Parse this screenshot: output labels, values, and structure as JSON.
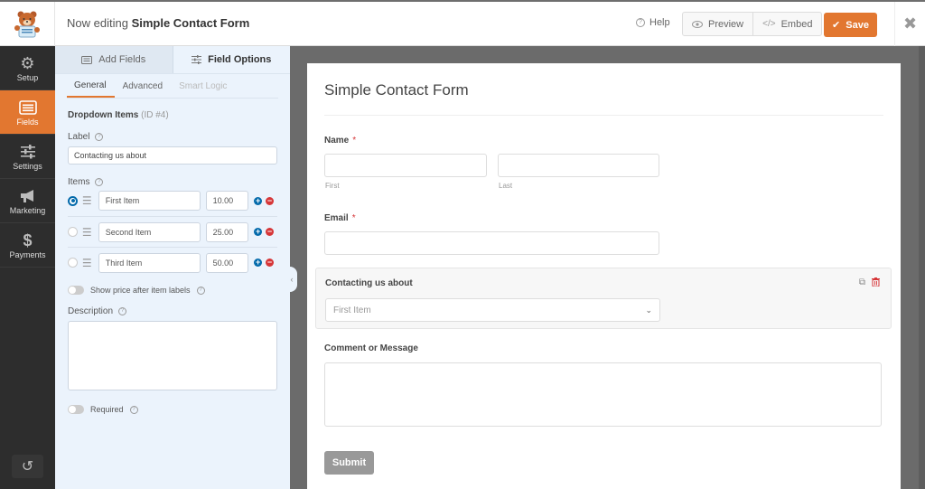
{
  "header": {
    "title_prefix": "Now editing",
    "form_name": "Simple Contact Form",
    "help_label": "Help",
    "preview_label": "Preview",
    "embed_label": "Embed",
    "save_label": "Save",
    "accent_color": "#e27730"
  },
  "leftnav": {
    "items": [
      {
        "label": "Setup",
        "icon": "gear-icon"
      },
      {
        "label": "Fields",
        "icon": "fields-icon",
        "active": true
      },
      {
        "label": "Settings",
        "icon": "sliders-icon"
      },
      {
        "label": "Marketing",
        "icon": "megaphone-icon"
      },
      {
        "label": "Payments",
        "icon": "dollar-icon"
      }
    ],
    "revisions_icon": "history-icon"
  },
  "panel": {
    "tabs": [
      {
        "label": "Add Fields",
        "active": false
      },
      {
        "label": "Field Options",
        "active": true
      }
    ],
    "subtabs": [
      {
        "label": "General",
        "active": true
      },
      {
        "label": "Advanced",
        "active": false
      },
      {
        "label": "Smart Logic",
        "disabled": true
      }
    ],
    "field_type": "Dropdown Items",
    "field_id": "(ID #4)",
    "label_caption": "Label",
    "label_value": "Contacting us about",
    "items_caption": "Items",
    "items": [
      {
        "name": "First Item",
        "price": "10.00",
        "selected": true
      },
      {
        "name": "Second Item",
        "price": "25.00",
        "selected": false
      },
      {
        "name": "Third Item",
        "price": "50.00",
        "selected": false
      }
    ],
    "show_price_label": "Show price after item labels",
    "show_price_enabled": false,
    "description_caption": "Description",
    "description_value": "",
    "required_label": "Required",
    "required_enabled": false
  },
  "form": {
    "title": "Simple Contact Form",
    "name_label": "Name",
    "name_required": "*",
    "first_sublabel": "First",
    "last_sublabel": "Last",
    "email_label": "Email",
    "email_required": "*",
    "dropdown_label": "Contacting us about",
    "dropdown_value": "First Item",
    "message_label": "Comment or Message",
    "submit_label": "Submit"
  }
}
